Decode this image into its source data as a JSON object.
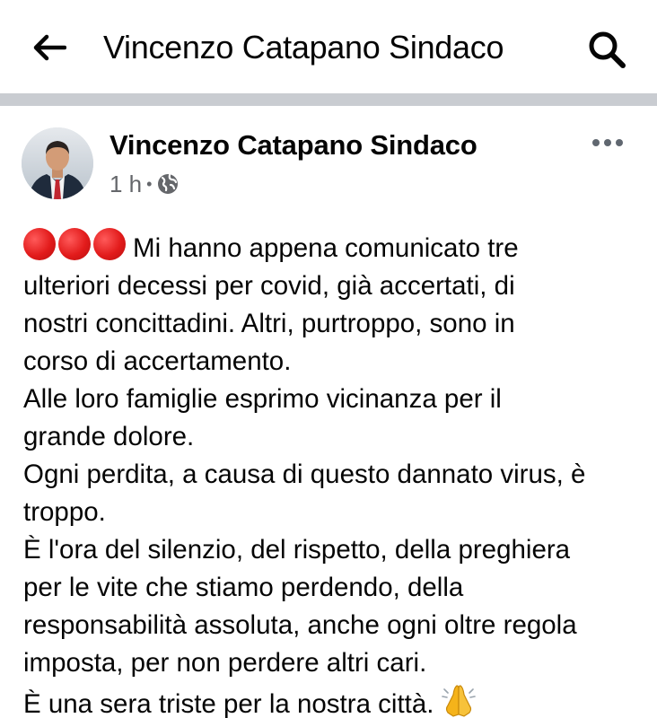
{
  "header": {
    "title": "Vincenzo Catapano Sindaco",
    "back_icon": "arrow-left-icon",
    "search_icon": "search-icon"
  },
  "post": {
    "author": "Vincenzo Catapano Sindaco",
    "time": "1 h",
    "separator": "•",
    "privacy_icon": "globe-icon",
    "more_icon": "more-options-icon",
    "emoji_prefix": [
      "red-circle",
      "red-circle",
      "red-circle"
    ],
    "lines": [
      "Mi hanno appena comunicato tre",
      "ulteriori decessi per covid, già accertati, di",
      "nostri concittadini. Altri, purtroppo, sono in",
      "corso di accertamento.",
      "Alle loro famiglie esprimo vicinanza per il",
      "grande dolore.",
      "Ogni perdita, a causa di questo dannato virus, è",
      "troppo.",
      "È l'ora del silenzio, del rispetto, della preghiera",
      "per le vite che stiamo perdendo, della",
      "responsabilità assoluta, anche ogni oltre regola",
      "imposta, per non perdere altri cari.",
      "È una sera triste per la nostra città."
    ],
    "emoji_suffix": "folded-hands-icon"
  },
  "colors": {
    "divider": "#c9ccd1",
    "meta_text": "#65676b",
    "red_circle": "#e21b1b",
    "pray_emoji": "#f5b31a"
  }
}
